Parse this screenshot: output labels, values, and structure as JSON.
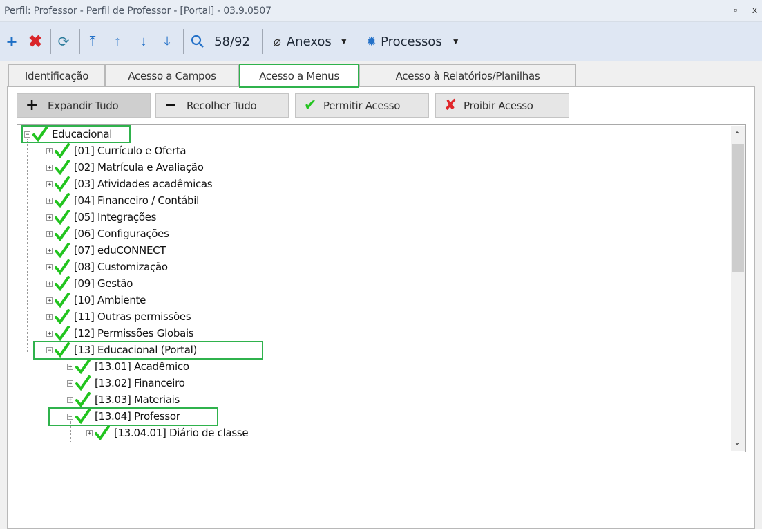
{
  "window": {
    "title": "Perfil: Professor - Perfil de Professor - [Portal] - 03.9.0507",
    "buttons": [
      "▫",
      "x"
    ]
  },
  "toolbar": {
    "record_counter": "58/92",
    "anexos_label": "Anexos",
    "processos_label": "Processos",
    "icons": [
      "add-icon",
      "delete-icon",
      "refresh-icon",
      "first-record-icon",
      "previous-record-icon",
      "next-record-icon",
      "last-record-icon",
      "search-icon",
      "paperclip-icon",
      "gear-icon"
    ]
  },
  "tabs": [
    {
      "label": "Identificação"
    },
    {
      "label": "Acesso a Campos"
    },
    {
      "label": "Acesso a Menus"
    },
    {
      "label": "Acesso à Relatórios/Planilhas"
    }
  ],
  "actions": {
    "expand_all": "Expandir Tudo",
    "collapse_all": "Recolher Tudo",
    "allow_access": "Permitir Acesso",
    "deny_access": "Proibir Acesso"
  },
  "tree": {
    "root": "Educacional",
    "items": [
      "[01] Currículo e Oferta",
      "[02] Matrícula e Avaliação",
      "[03] Atividades acadêmicas",
      "[04] Financeiro / Contábil",
      "[05] Integrações",
      "[06] Configurações",
      "[07] eduCONNECT",
      "[08] Customização",
      "[09] Gestão",
      "[10] Ambiente",
      "[11] Outras permissões",
      "[12] Permissões Globais",
      "[13] Educacional (Portal)"
    ],
    "portal_children": [
      "[13.01] Acadêmico",
      "[13.02] Financeiro",
      "[13.03] Materiais",
      "[13.04] Professor"
    ],
    "professor_children": [
      "[13.04.01] Diário de classe"
    ]
  },
  "colors": {
    "highlight": "#2fb24c",
    "check": "#22c41f",
    "deny": "#e0262a",
    "toolbar_bg": "#dfe7f3"
  }
}
